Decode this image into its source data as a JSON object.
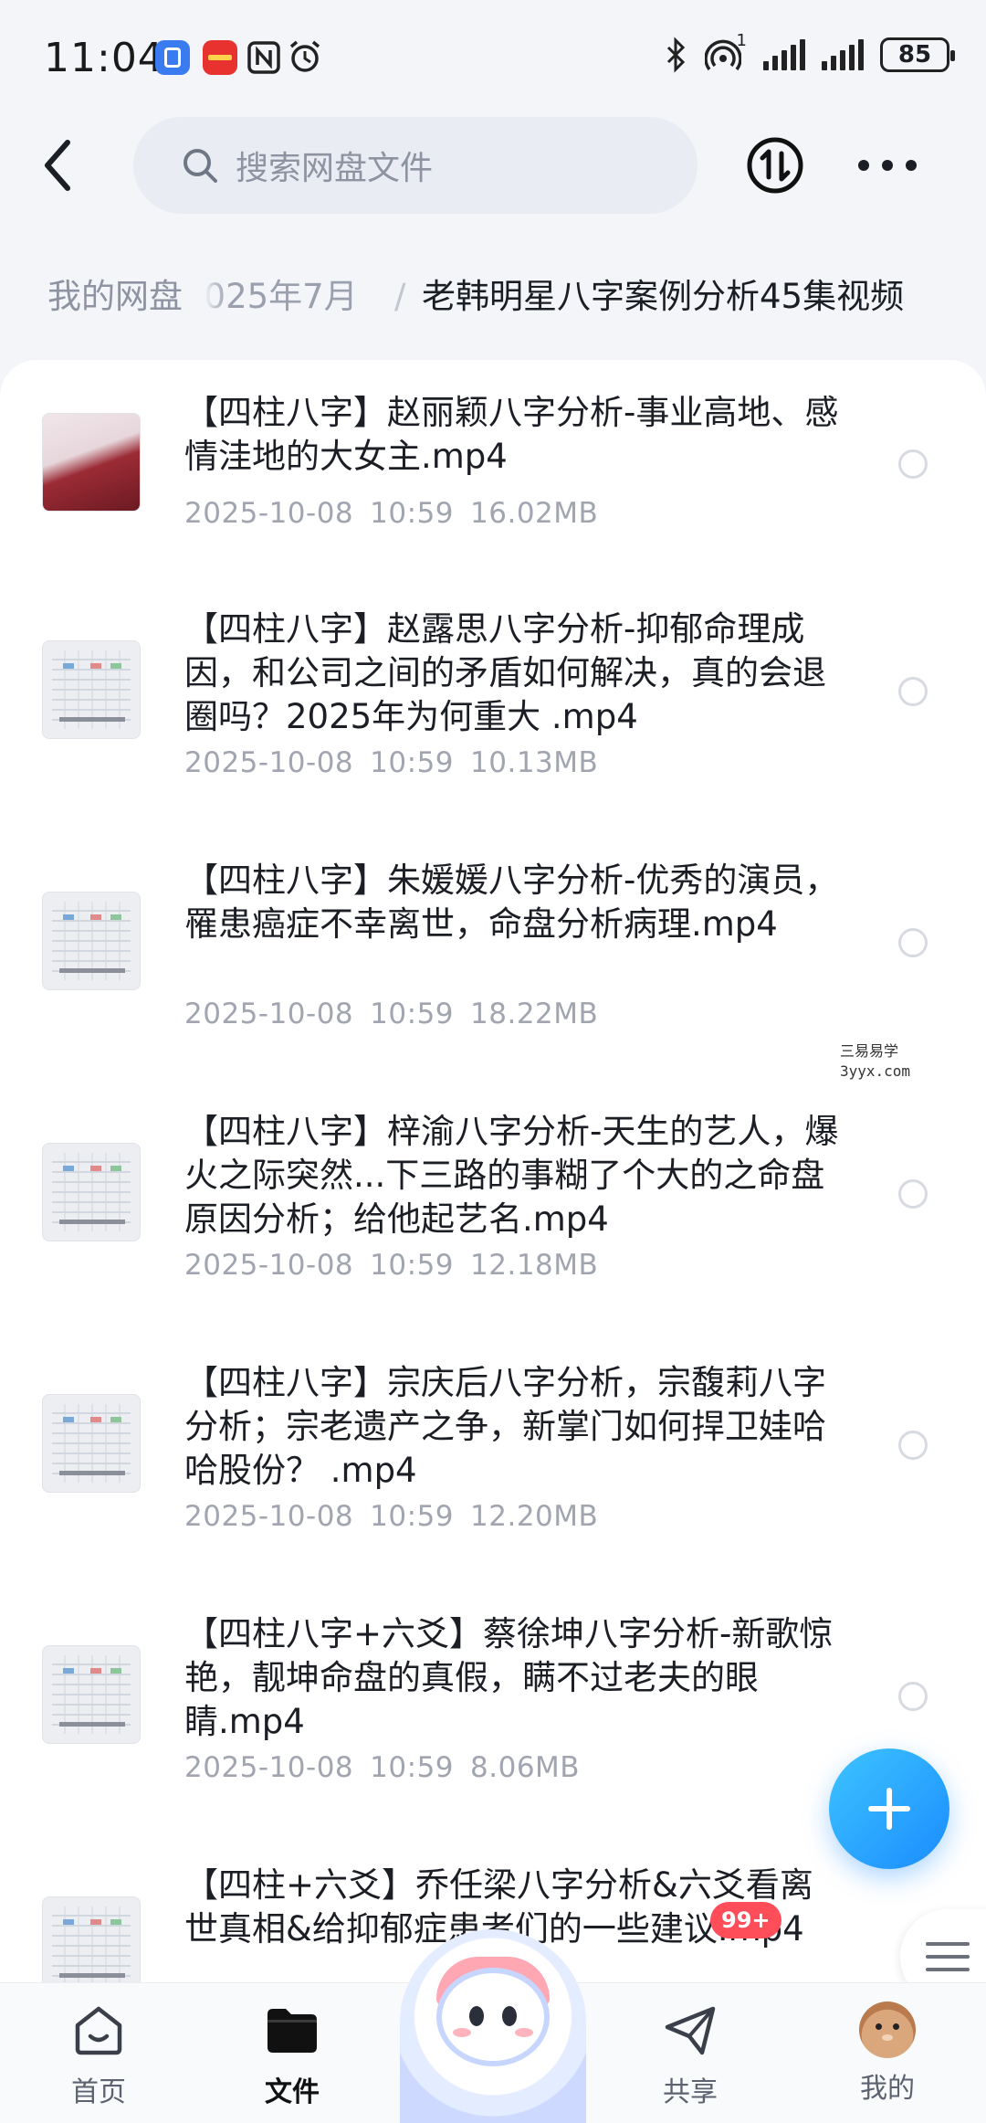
{
  "status_bar": {
    "time": "11:04",
    "network_sup": "1",
    "battery": "85",
    "app_icons": [
      "app-blue-icon",
      "app-red-icon",
      "nfc-icon",
      "alarm-icon"
    ]
  },
  "header": {
    "search_placeholder": "搜索网盘文件",
    "icons": [
      "back-icon",
      "search-icon",
      "transfer-icon",
      "more-icon"
    ]
  },
  "breadcrumb": {
    "root": "我的网盘",
    "middle": "2025年7月",
    "separator": "/",
    "current": "老韩明星八字案例分析45集视频"
  },
  "files": [
    {
      "title": "【四柱八字】赵丽颖八字分析-事业高地、感情洼地的大女主.mp4",
      "date": "2025-10-08",
      "time": "10:59",
      "size": "16.02MB"
    },
    {
      "title": "【四柱八字】赵露思八字分析-抑郁命理成因，和公司之间的矛盾如何解决，真的会退圈吗？2025年为何重大 .mp4",
      "date": "2025-10-08",
      "time": "10:59",
      "size": "10.13MB"
    },
    {
      "title": "【四柱八字】朱媛媛八字分析-优秀的演员，罹患癌症不幸离世，命盘分析病理.mp4",
      "date": "2025-10-08",
      "time": "10:59",
      "size": "18.22MB"
    },
    {
      "title": "【四柱八字】梓渝八字分析-天生的艺人，爆火之际突然...下三路的事糊了个大的之命盘原因分析；给他起艺名.mp4",
      "date": "2025-10-08",
      "time": "10:59",
      "size": "12.18MB"
    },
    {
      "title": "【四柱八字】宗庆后八字分析，宗馥莉八字分析；宗老遗产之争，新掌门如何捍卫娃哈哈股份？ .mp4",
      "date": "2025-10-08",
      "time": "10:59",
      "size": "12.20MB"
    },
    {
      "title": "【四柱八字+六爻】蔡徐坤八字分析-新歌惊艳，靓坤命盘的真假，瞒不过老夫的眼睛.mp4",
      "date": "2025-10-08",
      "time": "10:59",
      "size": "8.06MB"
    },
    {
      "title": "【四柱+六爻】乔任梁八字分析&六爻看离世真相&给抑郁症患者们的一些建议.mp4",
      "date": "",
      "time": "",
      "size": ""
    }
  ],
  "watermark": {
    "line1": "三易易学",
    "line2": "3yyx.com"
  },
  "bottom_nav": {
    "items": [
      {
        "label": "首页",
        "icon": "home-icon"
      },
      {
        "label": "文件",
        "icon": "folder-icon"
      },
      {
        "label": "",
        "icon": "mascot-icon"
      },
      {
        "label": "共享",
        "icon": "share-icon"
      },
      {
        "label": "我的",
        "icon": "avatar-icon"
      }
    ],
    "active": "文件",
    "share_badge": "99+"
  },
  "colors": {
    "accent": "#1a8cff",
    "badge": "#ff4d5a",
    "meta_text": "#a0a5b0"
  }
}
